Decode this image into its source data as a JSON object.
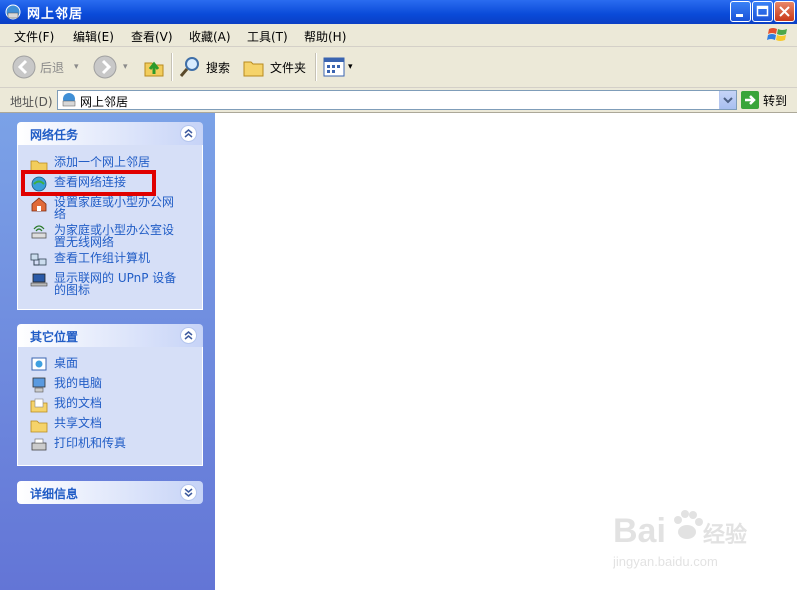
{
  "window": {
    "title": "网上邻居"
  },
  "menubar": {
    "items": [
      "文件(F)",
      "编辑(E)",
      "查看(V)",
      "收藏(A)",
      "工具(T)",
      "帮助(H)"
    ]
  },
  "toolbar": {
    "back_label": "后退",
    "search_label": "搜索",
    "folders_label": "文件夹"
  },
  "addressbar": {
    "label": "地址(D)",
    "value": "网上邻居",
    "go_label": "转到"
  },
  "left_pane": {
    "network_tasks": {
      "title": "网络任务",
      "items": [
        {
          "label": "添加一个网上邻居",
          "icon": "add-network-place-icon"
        },
        {
          "label": "查看网络连接",
          "icon": "network-connections-icon"
        },
        {
          "label": "设置家庭或小型办公网络",
          "icon": "home-network-icon"
        },
        {
          "label": "为家庭或小型办公室设置无线网络",
          "icon": "wireless-network-icon"
        },
        {
          "label": "查看工作组计算机",
          "icon": "workgroup-computers-icon"
        },
        {
          "label": "显示联网的 UPnP 设备的图标",
          "icon": "upnp-device-icon"
        }
      ]
    },
    "other_places": {
      "title": "其它位置",
      "items": [
        {
          "label": "桌面",
          "icon": "desktop-icon"
        },
        {
          "label": "我的电脑",
          "icon": "my-computer-icon"
        },
        {
          "label": "我的文档",
          "icon": "my-documents-icon"
        },
        {
          "label": "共享文档",
          "icon": "shared-documents-icon"
        },
        {
          "label": "打印机和传真",
          "icon": "printers-fax-icon"
        }
      ]
    },
    "details": {
      "title": "详细信息"
    }
  },
  "watermark": {
    "brand": "Bai du 经验",
    "url": "jingyan.baidu.com"
  },
  "colors": {
    "title_bar": "#0a4ad8",
    "task_link": "#215dc6",
    "highlight": "#e00000",
    "left_pane": "#7ba2e7"
  }
}
